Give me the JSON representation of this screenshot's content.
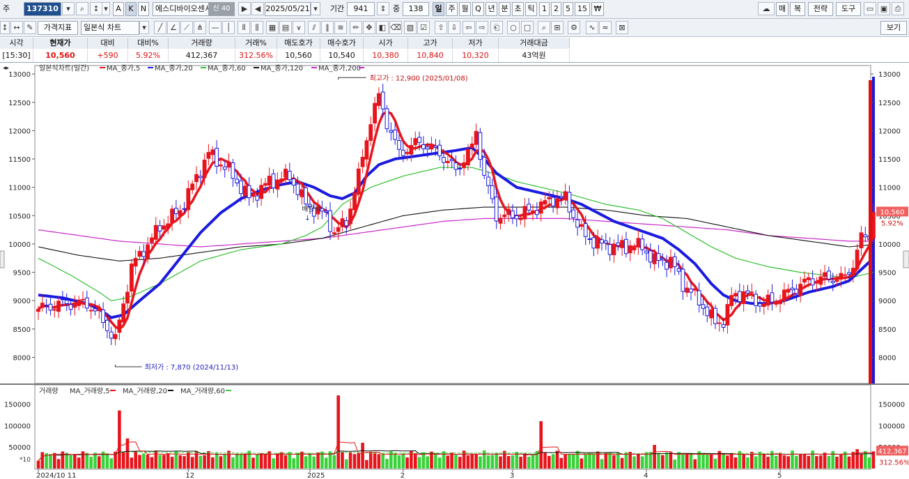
{
  "toolbar1": {
    "type_label": "주",
    "code": "137310",
    "name": "에스디바이오센서",
    "name_badge": "신 40",
    "date": "2025/05/21",
    "period_label": "기간",
    "period_value": "941",
    "interval_label": "중",
    "interval_value": "138",
    "period_buttons": [
      "일",
      "주",
      "월",
      "Q",
      "년",
      "분",
      "초",
      "틱",
      "1",
      "2",
      "5",
      "15",
      "₩"
    ],
    "k_buttons": [
      "A",
      "K",
      "N"
    ],
    "right_buttons": [
      "매",
      "복",
      "전략",
      "도구"
    ]
  },
  "toolbar2": {
    "price_index": "가격지표",
    "chart_type": "일본식 차트",
    "view_label": "보기"
  },
  "quote": {
    "headers": [
      "시각",
      "현재가",
      "대비",
      "대비%",
      "거래량",
      "거래%",
      "매도호가",
      "매수호가",
      "시가",
      "고가",
      "저가",
      "거래대금"
    ],
    "values": [
      "[15:30]",
      "10,560",
      "+590",
      "5.92%",
      "412,367",
      "312.56%",
      "10,560",
      "10,540",
      "10,380",
      "10,840",
      "10,320",
      "43억원"
    ]
  },
  "colors": {
    "up": "#e8141c",
    "down": "#1818e0",
    "ma5": "#e8141c",
    "ma20": "#1a1ae0",
    "ma60": "#2fbf2f",
    "ma120": "#111111",
    "ma200": "#c828c8",
    "vol_up": "#e8141c",
    "vol_green": "#3ad23a"
  },
  "chart_data": {
    "type": "candlestick",
    "title": "일본식차트(일간)",
    "legend": [
      "MA_종가,5",
      "MA_종가,20",
      "MA_종가,60",
      "MA_종가,120",
      "MA_종가,200"
    ],
    "y_ticks": [
      8000,
      8500,
      9000,
      9500,
      10000,
      10500,
      11000,
      11500,
      12000,
      12500,
      13000
    ],
    "ylim": [
      7600,
      13100
    ],
    "x_labels": [
      "2024/10 11",
      "12",
      "2025",
      "2",
      "3",
      "4",
      "5"
    ],
    "high_annotation": "최고가 : 12,900 (2025/01/08)",
    "low_annotation": "최저가 : 7,870 (2024/11/13)",
    "dividend_label": "배당락",
    "last_price": "10,560",
    "last_change": "5.92%",
    "anchors": [
      [
        0,
        8850
      ],
      [
        6,
        8950
      ],
      [
        12,
        8950
      ],
      [
        15,
        8750
      ],
      [
        19,
        8300
      ],
      [
        23,
        9600
      ],
      [
        30,
        10300
      ],
      [
        35,
        10600
      ],
      [
        42,
        11600
      ],
      [
        47,
        11300
      ],
      [
        52,
        10800
      ],
      [
        57,
        11100
      ],
      [
        62,
        11200
      ],
      [
        66,
        10700
      ],
      [
        71,
        10500
      ],
      [
        73,
        10200
      ],
      [
        76,
        10400
      ],
      [
        79,
        11200
      ],
      [
        82,
        12200
      ],
      [
        84,
        12600
      ],
      [
        86,
        12150
      ],
      [
        89,
        11600
      ],
      [
        94,
        11800
      ],
      [
        99,
        11600
      ],
      [
        103,
        11300
      ],
      [
        107,
        11700
      ],
      [
        108,
        12000
      ],
      [
        110,
        11200
      ],
      [
        113,
        10500
      ],
      [
        118,
        10500
      ],
      [
        122,
        10600
      ],
      [
        127,
        10800
      ],
      [
        130,
        10800
      ],
      [
        134,
        10200
      ],
      [
        138,
        10000
      ],
      [
        142,
        9950
      ],
      [
        146,
        9950
      ],
      [
        149,
        9950
      ],
      [
        152,
        9700
      ],
      [
        156,
        9700
      ],
      [
        159,
        9300
      ],
      [
        163,
        9000
      ],
      [
        167,
        8600
      ],
      [
        169,
        8650
      ],
      [
        171,
        9050
      ],
      [
        174,
        9150
      ],
      [
        178,
        8950
      ],
      [
        182,
        9000
      ],
      [
        186,
        9200
      ],
      [
        190,
        9350
      ],
      [
        194,
        9400
      ],
      [
        199,
        9400
      ],
      [
        201,
        9650
      ],
      [
        203,
        10100
      ],
      [
        205,
        10150
      ],
      [
        206,
        10560
      ]
    ],
    "ma20_curve": [
      [
        0,
        9100
      ],
      [
        6,
        9050
      ],
      [
        12,
        8950
      ],
      [
        15,
        8850
      ],
      [
        18,
        8700
      ],
      [
        21,
        8750
      ],
      [
        25,
        9000
      ],
      [
        30,
        9300
      ],
      [
        35,
        9750
      ],
      [
        40,
        10200
      ],
      [
        45,
        10550
      ],
      [
        50,
        10800
      ],
      [
        55,
        10950
      ],
      [
        60,
        11050
      ],
      [
        64,
        11100
      ],
      [
        68,
        11000
      ],
      [
        72,
        10850
      ],
      [
        75,
        10800
      ],
      [
        78,
        10900
      ],
      [
        81,
        11200
      ],
      [
        84,
        11400
      ],
      [
        88,
        11500
      ],
      [
        93,
        11550
      ],
      [
        98,
        11600
      ],
      [
        103,
        11650
      ],
      [
        107,
        11700
      ],
      [
        110,
        11500
      ],
      [
        113,
        11250
      ],
      [
        118,
        11000
      ],
      [
        124,
        10900
      ],
      [
        130,
        10800
      ],
      [
        134,
        10700
      ],
      [
        138,
        10550
      ],
      [
        142,
        10400
      ],
      [
        148,
        10250
      ],
      [
        154,
        10100
      ],
      [
        158,
        9900
      ],
      [
        162,
        9650
      ],
      [
        166,
        9300
      ],
      [
        169,
        9100
      ],
      [
        172,
        9000
      ],
      [
        176,
        8950
      ],
      [
        180,
        8950
      ],
      [
        184,
        9000
      ],
      [
        190,
        9150
      ],
      [
        196,
        9250
      ],
      [
        200,
        9350
      ],
      [
        203,
        9550
      ],
      [
        206,
        9750
      ]
    ],
    "ma60_curve": [
      [
        0,
        9750
      ],
      [
        8,
        9450
      ],
      [
        15,
        9150
      ],
      [
        18,
        9000
      ],
      [
        22,
        9050
      ],
      [
        30,
        9300
      ],
      [
        40,
        9700
      ],
      [
        50,
        9900
      ],
      [
        60,
        10000
      ],
      [
        66,
        10150
      ],
      [
        70,
        10300
      ],
      [
        75,
        10700
      ],
      [
        82,
        11000
      ],
      [
        90,
        11200
      ],
      [
        99,
        11350
      ],
      [
        107,
        11350
      ],
      [
        112,
        11250
      ],
      [
        118,
        11100
      ],
      [
        124,
        11000
      ],
      [
        130,
        10900
      ],
      [
        140,
        10700
      ],
      [
        148,
        10600
      ],
      [
        154,
        10450
      ],
      [
        160,
        10200
      ],
      [
        166,
        9950
      ],
      [
        172,
        9750
      ],
      [
        180,
        9600
      ],
      [
        188,
        9500
      ],
      [
        194,
        9450
      ],
      [
        200,
        9400
      ],
      [
        206,
        9500
      ]
    ],
    "ma120_curve": [
      [
        0,
        9950
      ],
      [
        10,
        9800
      ],
      [
        20,
        9700
      ],
      [
        30,
        9750
      ],
      [
        40,
        9850
      ],
      [
        50,
        9950
      ],
      [
        60,
        10000
      ],
      [
        70,
        10100
      ],
      [
        80,
        10300
      ],
      [
        90,
        10500
      ],
      [
        100,
        10600
      ],
      [
        110,
        10650
      ],
      [
        120,
        10650
      ],
      [
        130,
        10650
      ],
      [
        140,
        10600
      ],
      [
        150,
        10500
      ],
      [
        160,
        10450
      ],
      [
        170,
        10300
      ],
      [
        180,
        10150
      ],
      [
        190,
        10050
      ],
      [
        200,
        9950
      ],
      [
        206,
        9990
      ]
    ],
    "ma200_curve": [
      [
        0,
        10250
      ],
      [
        10,
        10150
      ],
      [
        20,
        10050
      ],
      [
        30,
        10000
      ],
      [
        40,
        9950
      ],
      [
        50,
        10000
      ],
      [
        60,
        10050
      ],
      [
        70,
        10100
      ],
      [
        80,
        10200
      ],
      [
        90,
        10300
      ],
      [
        100,
        10400
      ],
      [
        110,
        10450
      ],
      [
        120,
        10450
      ],
      [
        130,
        10450
      ],
      [
        140,
        10400
      ],
      [
        150,
        10350
      ],
      [
        160,
        10300
      ],
      [
        170,
        10250
      ],
      [
        180,
        10150
      ],
      [
        190,
        10100
      ],
      [
        200,
        10050
      ],
      [
        206,
        10050
      ]
    ],
    "volume": {
      "title": "거래량",
      "legend": [
        "MA_거래량,5",
        "MA_거래량,20",
        "MA_거래량,60"
      ],
      "y_ticks": [
        50000,
        100000,
        150000
      ],
      "ylim": [
        0,
        175000
      ],
      "scale_note": "*10",
      "last_volume": "412,367",
      "last_pct": "312.56%",
      "spikes": [
        [
          20,
          135000
        ],
        [
          22,
          70000
        ],
        [
          72,
          40000
        ],
        [
          74,
          170000
        ],
        [
          80,
          60000
        ],
        [
          120,
          35000
        ],
        [
          124,
          110000
        ],
        [
          152,
          55000
        ],
        [
          202,
          45000
        ],
        [
          206,
          40000
        ]
      ]
    }
  }
}
